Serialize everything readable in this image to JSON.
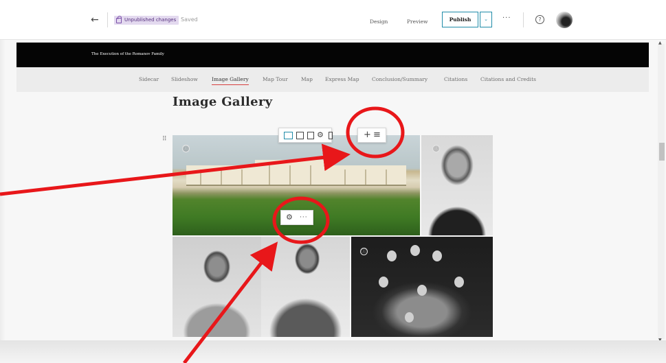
{
  "topbar": {
    "back_icon": "arrow-left-icon",
    "status_badge": "Unpublished changes",
    "saved_label": "Saved",
    "design_label": "Design",
    "preview_label": "Preview",
    "publish_label": "Publish",
    "publish_dropdown": "⌄",
    "more_label": "···",
    "help_label": "?"
  },
  "story": {
    "title": "The Execution of the Romanov Family"
  },
  "nav": {
    "items": [
      "Sidecar",
      "Slideshow",
      "Image Gallery",
      "Map Tour",
      "Map",
      "Express Map",
      "Conclusion/Summary",
      "Citations",
      "Citations and Credits"
    ],
    "active": "Image Gallery"
  },
  "content": {
    "section_title": "Image Gallery",
    "info_glyph": "ⓘ",
    "images": [
      {
        "name": "palace",
        "info": true
      },
      {
        "name": "nicholas-portrait",
        "info": true
      },
      {
        "name": "alexandra",
        "info": false
      },
      {
        "name": "nicholas-uniform",
        "info": false
      },
      {
        "name": "family",
        "info": true
      }
    ]
  },
  "toolbars": {
    "block": [
      "layout-full-icon",
      "layout-wide-icon",
      "layout-standard-icon",
      "gear-icon",
      "trash-icon"
    ],
    "block_add": "+",
    "block_menu": "≡",
    "image_settings": "⚙",
    "image_more": "···"
  },
  "annotations": {
    "color": "#e8171a",
    "circles": 2,
    "arrows": 2
  }
}
